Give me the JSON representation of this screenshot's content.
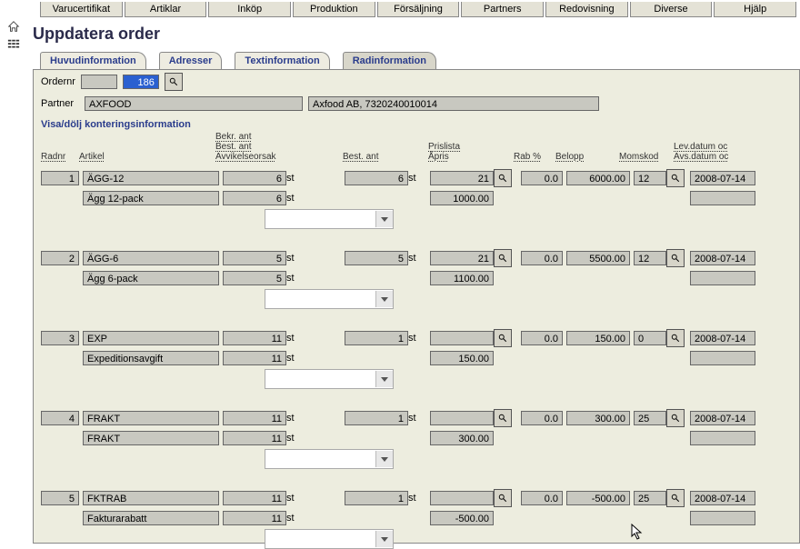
{
  "menu": [
    "Varucertifikat",
    "Artiklar",
    "Inköp",
    "Produktion",
    "Försäljning",
    "Partners",
    "Redovisning",
    "Diverse",
    "Hjälp"
  ],
  "page_title": "Uppdatera order",
  "tabs": [
    {
      "label": "Huvudinformation",
      "active": false
    },
    {
      "label": "Adresser",
      "active": false
    },
    {
      "label": "Textinformation",
      "active": false
    },
    {
      "label": "Radinformation",
      "active": true
    }
  ],
  "ordernr": {
    "label": "Ordernr",
    "value": "186"
  },
  "partner": {
    "label": "Partner",
    "code": "AXFOOD",
    "name": "Axfood AB, 7320240010014"
  },
  "block_title": "Visa/dölj konteringsinformation",
  "headers": {
    "radnr": "Radnr",
    "artikel": "Artikel",
    "bekr": "Bekr. ant\nBest. ant\nAvvikelseorsak",
    "best": "Best. ant",
    "prislista": "Prislista\nÅpris",
    "rab": "Rab %",
    "belopp": "Belopp",
    "momskod": "Momskod",
    "lev": "Lev.datum oc\nAvs.datum oc"
  },
  "rows": [
    {
      "nr": "1",
      "art": "ÄGG-12",
      "desc": "Ägg 12-pack",
      "bekr": "6",
      "best_ant": "6",
      "unit": "st",
      "best": "6",
      "pl": "21",
      "apris": "1000.00",
      "rab": "0.0",
      "belopp": "6000.00",
      "mk": "12",
      "date": "2008-07-14"
    },
    {
      "nr": "2",
      "art": "ÄGG-6",
      "desc": "Ägg 6-pack",
      "bekr": "5",
      "best_ant": "5",
      "unit": "st",
      "best": "5",
      "pl": "21",
      "apris": "1100.00",
      "rab": "0.0",
      "belopp": "5500.00",
      "mk": "12",
      "date": "2008-07-14"
    },
    {
      "nr": "3",
      "art": "EXP",
      "desc": "Expeditionsavgift",
      "bekr": "11",
      "best_ant": "11",
      "unit": "st",
      "best": "1",
      "pl": "",
      "apris": "150.00",
      "rab": "0.0",
      "belopp": "150.00",
      "mk": "0",
      "date": "2008-07-14"
    },
    {
      "nr": "4",
      "art": "FRAKT",
      "desc": "FRAKT",
      "bekr": "11",
      "best_ant": "11",
      "unit": "st",
      "best": "1",
      "pl": "",
      "apris": "300.00",
      "rab": "0.0",
      "belopp": "300.00",
      "mk": "25",
      "date": "2008-07-14"
    },
    {
      "nr": "5",
      "art": "FKTRAB",
      "desc": "Fakturarabatt",
      "bekr": "11",
      "best_ant": "11",
      "unit": "st",
      "best": "1",
      "pl": "",
      "apris": "-500.00",
      "rab": "0.0",
      "belopp": "-500.00",
      "mk": "25",
      "date": "2008-07-14"
    }
  ]
}
